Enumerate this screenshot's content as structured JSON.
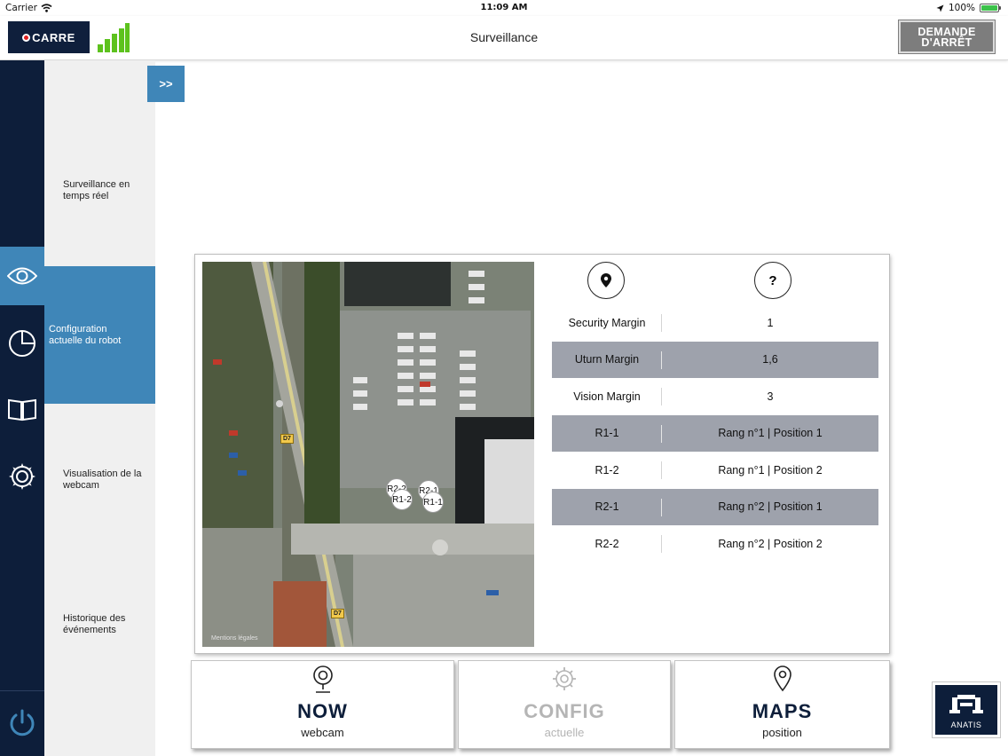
{
  "status_bar": {
    "carrier": "Carrier",
    "time": "11:09 AM",
    "battery": "100%"
  },
  "header": {
    "logo": "CARRE",
    "title": "Surveillance",
    "stop_button": [
      "DEMANDE",
      "D'ARRÊT"
    ]
  },
  "sidebar": {
    "expand_label": ">>",
    "items": [
      {
        "label": "Surveillance en temps réel",
        "icon": "eye-icon",
        "active": false
      },
      {
        "label": "Configuration actuelle du robot",
        "icon": "pie-chart-icon",
        "active": true
      },
      {
        "label": "Visualisation de la webcam",
        "icon": "book-icon",
        "active": false
      },
      {
        "label": "Historique des événements",
        "icon": "gear-icon",
        "active": false
      }
    ],
    "power_icon": "power-icon"
  },
  "map": {
    "legal": "Mentions légales",
    "road_labels": [
      "D7",
      "D7"
    ],
    "markers": [
      "R2-2",
      "R1-2",
      "R2-1",
      "R1-1"
    ]
  },
  "config_table": {
    "header_icons": [
      "location-pin-icon",
      "help-icon"
    ],
    "help_symbol": "?",
    "rows": [
      {
        "name": "Security Margin",
        "value": "1",
        "shaded": false
      },
      {
        "name": "Uturn Margin",
        "value": "1,6",
        "shaded": true
      },
      {
        "name": "Vision Margin",
        "value": "3",
        "shaded": false
      },
      {
        "name": "R1-1",
        "value": "Rang n°1 | Position 1",
        "shaded": true
      },
      {
        "name": "R1-2",
        "value": "Rang n°1 | Position 2",
        "shaded": false
      },
      {
        "name": "R2-1",
        "value": "Rang n°2 | Position 1",
        "shaded": true
      },
      {
        "name": "R2-2",
        "value": "Rang n°2 | Position 2",
        "shaded": false
      }
    ]
  },
  "bottom_buttons": [
    {
      "title": "NOW",
      "subtitle": "webcam",
      "icon": "webcam-icon",
      "disabled": false
    },
    {
      "title": "CONFIG",
      "subtitle": "actuelle",
      "icon": "config-gear-icon",
      "disabled": true
    },
    {
      "title": "MAPS",
      "subtitle": "position",
      "icon": "map-pin-icon",
      "disabled": false
    }
  ],
  "anatis": {
    "label": "ANATIS"
  },
  "colors": {
    "navy": "#0d1e3a",
    "accent": "#3f86b8",
    "shaded_row": "#9ea2ac",
    "stop_button": "#7d7d7d"
  }
}
